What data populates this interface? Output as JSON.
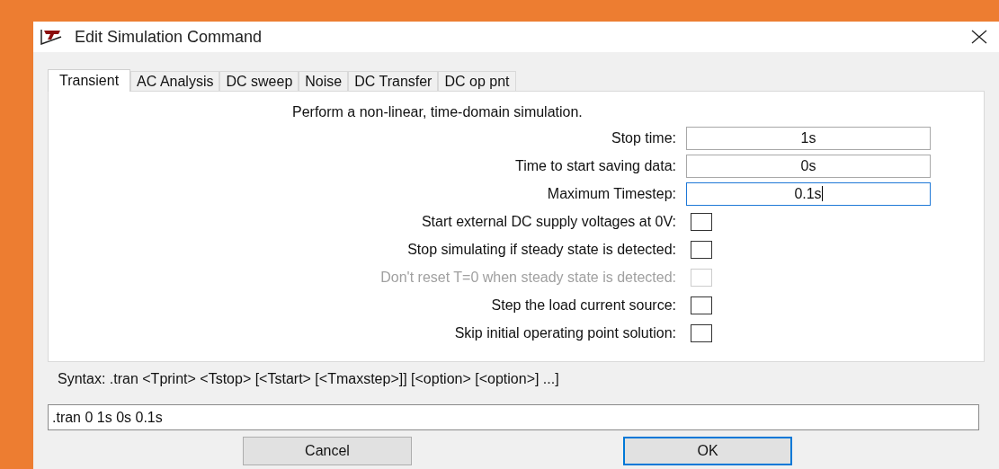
{
  "window": {
    "title": "Edit Simulation Command"
  },
  "tabs": [
    {
      "label": "Transient",
      "selected": true
    },
    {
      "label": "AC Analysis",
      "selected": false
    },
    {
      "label": "DC sweep",
      "selected": false
    },
    {
      "label": "Noise",
      "selected": false
    },
    {
      "label": "DC Transfer",
      "selected": false
    },
    {
      "label": "DC op pnt",
      "selected": false
    }
  ],
  "description": "Perform a non-linear, time-domain simulation.",
  "fields": [
    {
      "kind": "text",
      "label": "Stop time:",
      "value": "1s",
      "focused": false
    },
    {
      "kind": "text",
      "label": "Time to start saving data:",
      "value": "0s",
      "focused": false
    },
    {
      "kind": "text",
      "label": "Maximum Timestep:",
      "value": "0.1s",
      "focused": true
    },
    {
      "kind": "checkbox",
      "label": "Start external DC supply voltages at 0V:",
      "checked": false,
      "disabled": false
    },
    {
      "kind": "checkbox",
      "label": "Stop simulating if steady state is detected:",
      "checked": false,
      "disabled": false
    },
    {
      "kind": "checkbox",
      "label": "Don't reset T=0 when steady state is detected:",
      "checked": false,
      "disabled": true
    },
    {
      "kind": "checkbox",
      "label": "Step the load current source:",
      "checked": false,
      "disabled": false
    },
    {
      "kind": "checkbox",
      "label": "Skip initial operating point solution:",
      "checked": false,
      "disabled": false
    }
  ],
  "syntax": "Syntax:  .tran <Tprint> <Tstop> [<Tstart> [<Tmaxstep>]] [<option> [<option>] ...]",
  "command": ".tran 0 1s 0s 0.1s",
  "buttons": [
    {
      "label": "Cancel",
      "default": false
    },
    {
      "label": "OK",
      "default": true
    }
  ]
}
